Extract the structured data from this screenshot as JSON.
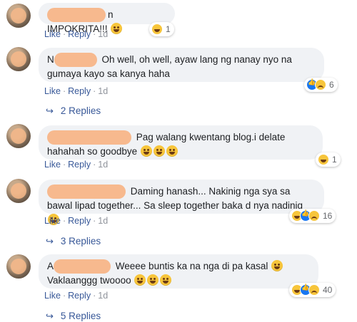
{
  "comments": [
    {
      "text": "n IMPOKRITA!!!",
      "actions": {
        "like": "Like",
        "reply": "Reply",
        "time": "1d"
      },
      "reaction_count": "1",
      "reactions": [
        "haha"
      ]
    },
    {
      "prefix": "N",
      "text": "Oh well, oh well, ayaw lang ng nanay nyo na gumaya kayo sa kanya haha",
      "actions": {
        "like": "Like",
        "reply": "Reply",
        "time": "1d"
      },
      "reaction_count": "6",
      "reactions": [
        "like",
        "sad"
      ],
      "replies": "2 Replies"
    },
    {
      "text": "Pag walang kwentang blog.i delate hahahah so goodbye",
      "actions": {
        "like": "Like",
        "reply": "Reply",
        "time": "1d"
      },
      "reaction_count": "1",
      "reactions": [
        "haha"
      ]
    },
    {
      "text": "Daming hanash... Nakinig nga sya sa bawal lipad together... Sa sleep together baka d nya nadinig",
      "actions": {
        "like": "Like",
        "reply": "Reply",
        "time": "1d"
      },
      "reaction_count": "16",
      "reactions": [
        "haha",
        "like",
        "sad"
      ],
      "replies": "3 Replies"
    },
    {
      "prefix": "A",
      "text": "Weeee buntis ka na nga di pa kasal",
      "text2": "Vaklaanggg twoooo",
      "actions": {
        "like": "Like",
        "reply": "Reply",
        "time": "1d"
      },
      "reaction_count": "40",
      "reactions": [
        "haha",
        "like",
        "sad"
      ],
      "replies": "5 Replies"
    }
  ],
  "colors": {
    "link": "#385898",
    "bubble": "#f0f2f5",
    "muted": "#90949c"
  }
}
